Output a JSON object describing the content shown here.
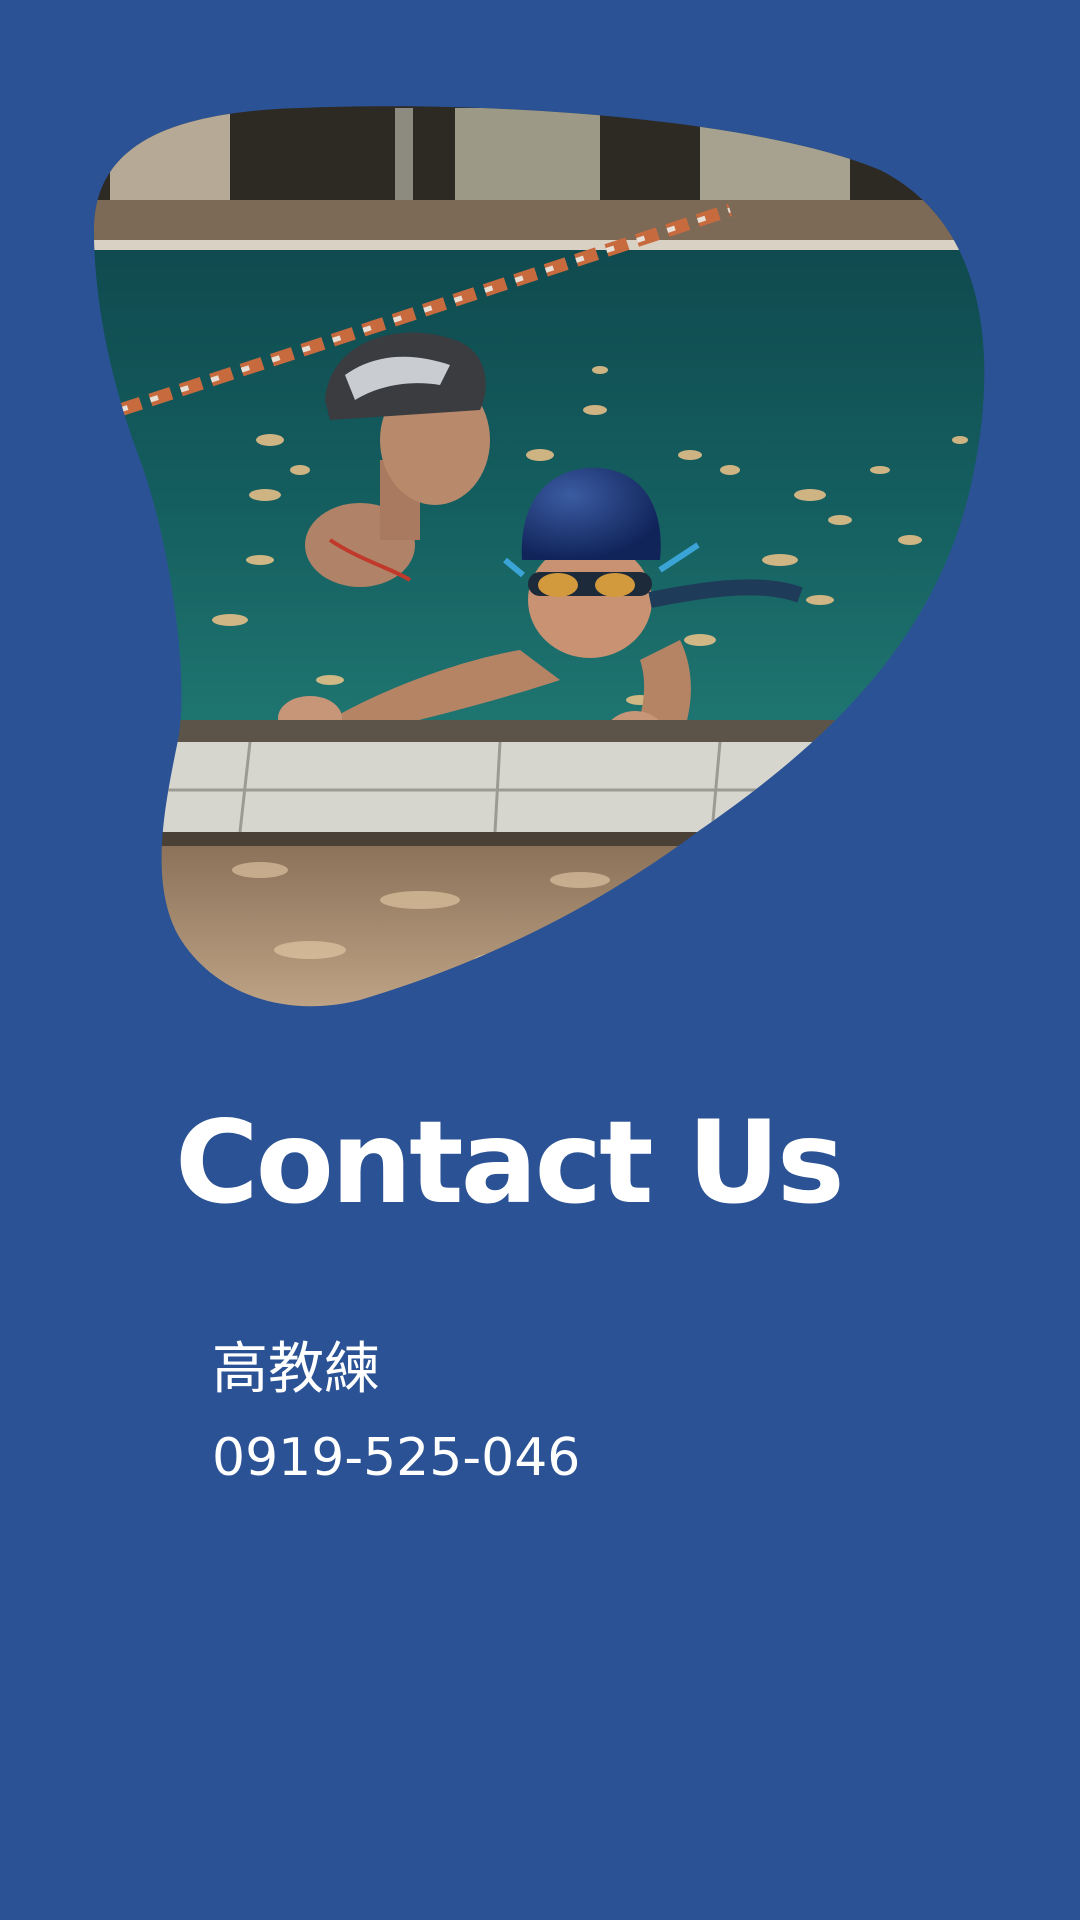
{
  "contact": {
    "title": "Contact Us",
    "name": "高教練",
    "phone": "0919-525-046"
  },
  "colors": {
    "background": "#2a5294",
    "text": "#ffffff"
  },
  "photo": {
    "subject": "swimming-lesson-photo"
  }
}
